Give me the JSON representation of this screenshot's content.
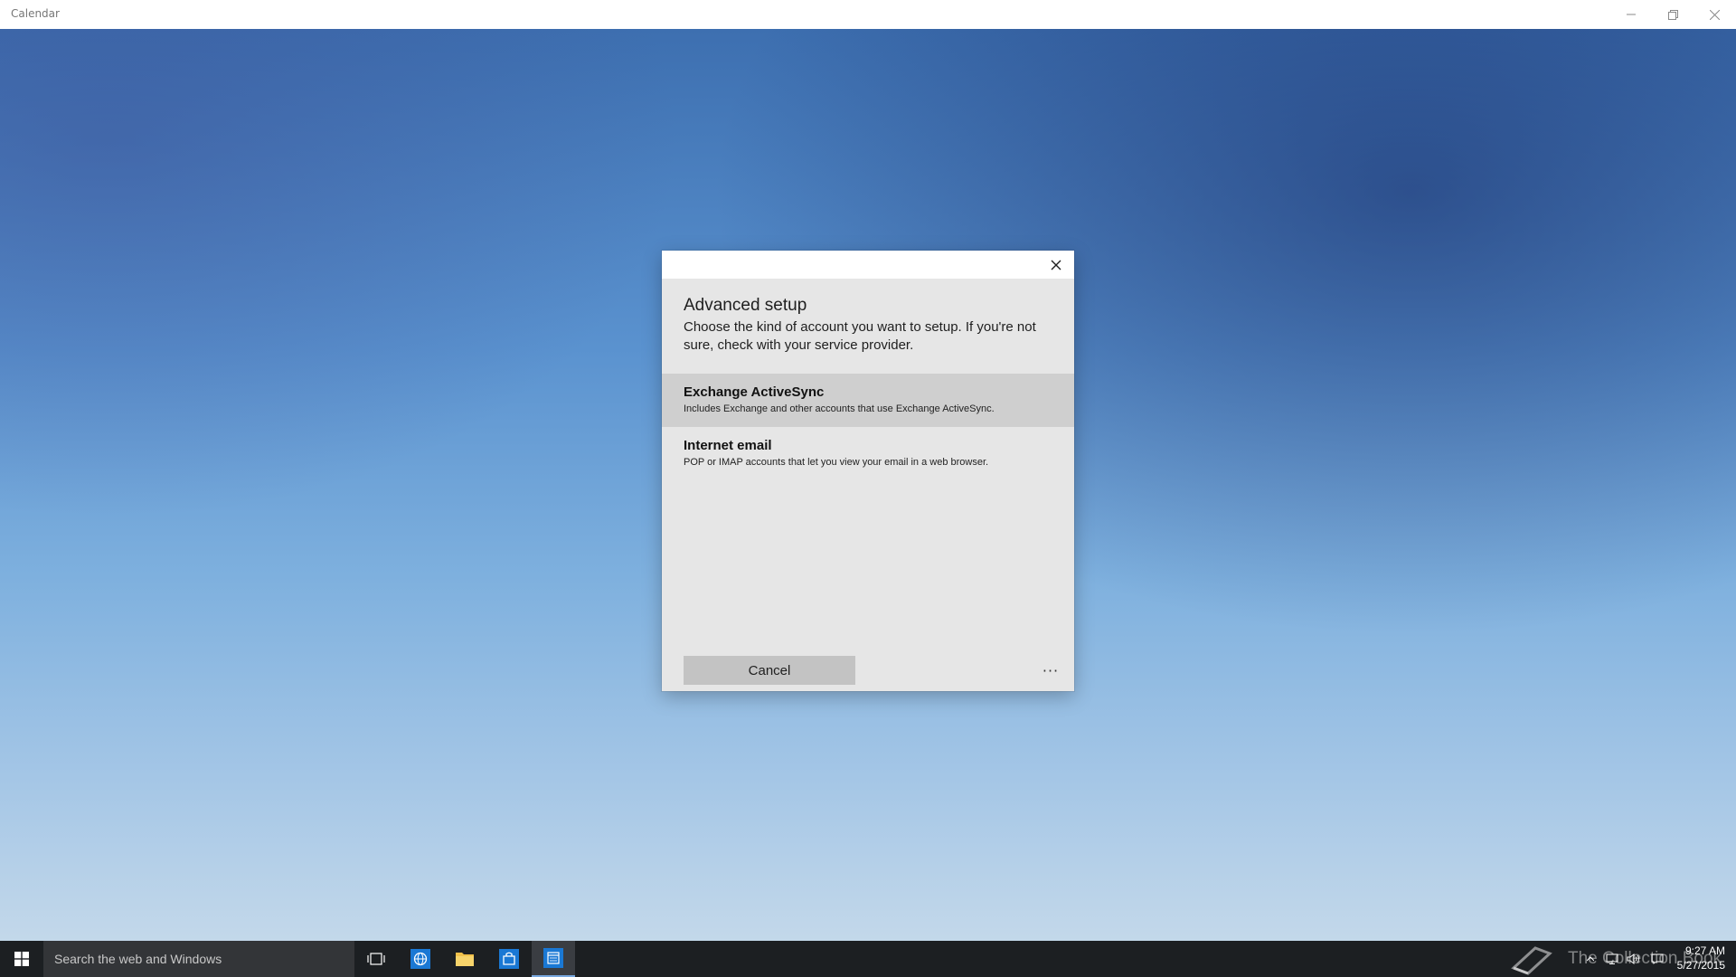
{
  "window": {
    "title": "Calendar",
    "minimize_icon": "minimize-icon",
    "restore_icon": "restore-icon",
    "close_icon": "close-icon"
  },
  "dialog": {
    "title": "Advanced setup",
    "description": "Choose the kind of account you want to setup. If you're not sure, check with your service provider.",
    "options": [
      {
        "title": "Exchange ActiveSync",
        "description": "Includes Exchange and other accounts that use Exchange ActiveSync.",
        "selected": true
      },
      {
        "title": "Internet email",
        "description": "POP or IMAP accounts that let you view your email in a web browser.",
        "selected": false
      }
    ],
    "cancel_label": "Cancel",
    "more_label": "···"
  },
  "taskbar": {
    "search_placeholder": "Search the web and Windows",
    "apps": [
      "task-view-icon",
      "browser-icon",
      "file-explorer-icon",
      "store-icon",
      "calendar-icon"
    ],
    "active_app": "calendar-icon",
    "watermark": "The Collection Book",
    "clock_time": "9:27 AM",
    "clock_date": "5/27/2015"
  },
  "colors": {
    "taskbar": "#1c1f22",
    "dialog_bg": "#e6e6e6",
    "selected_option": "#cfcfcf",
    "cancel_button": "#c3c3c3"
  }
}
